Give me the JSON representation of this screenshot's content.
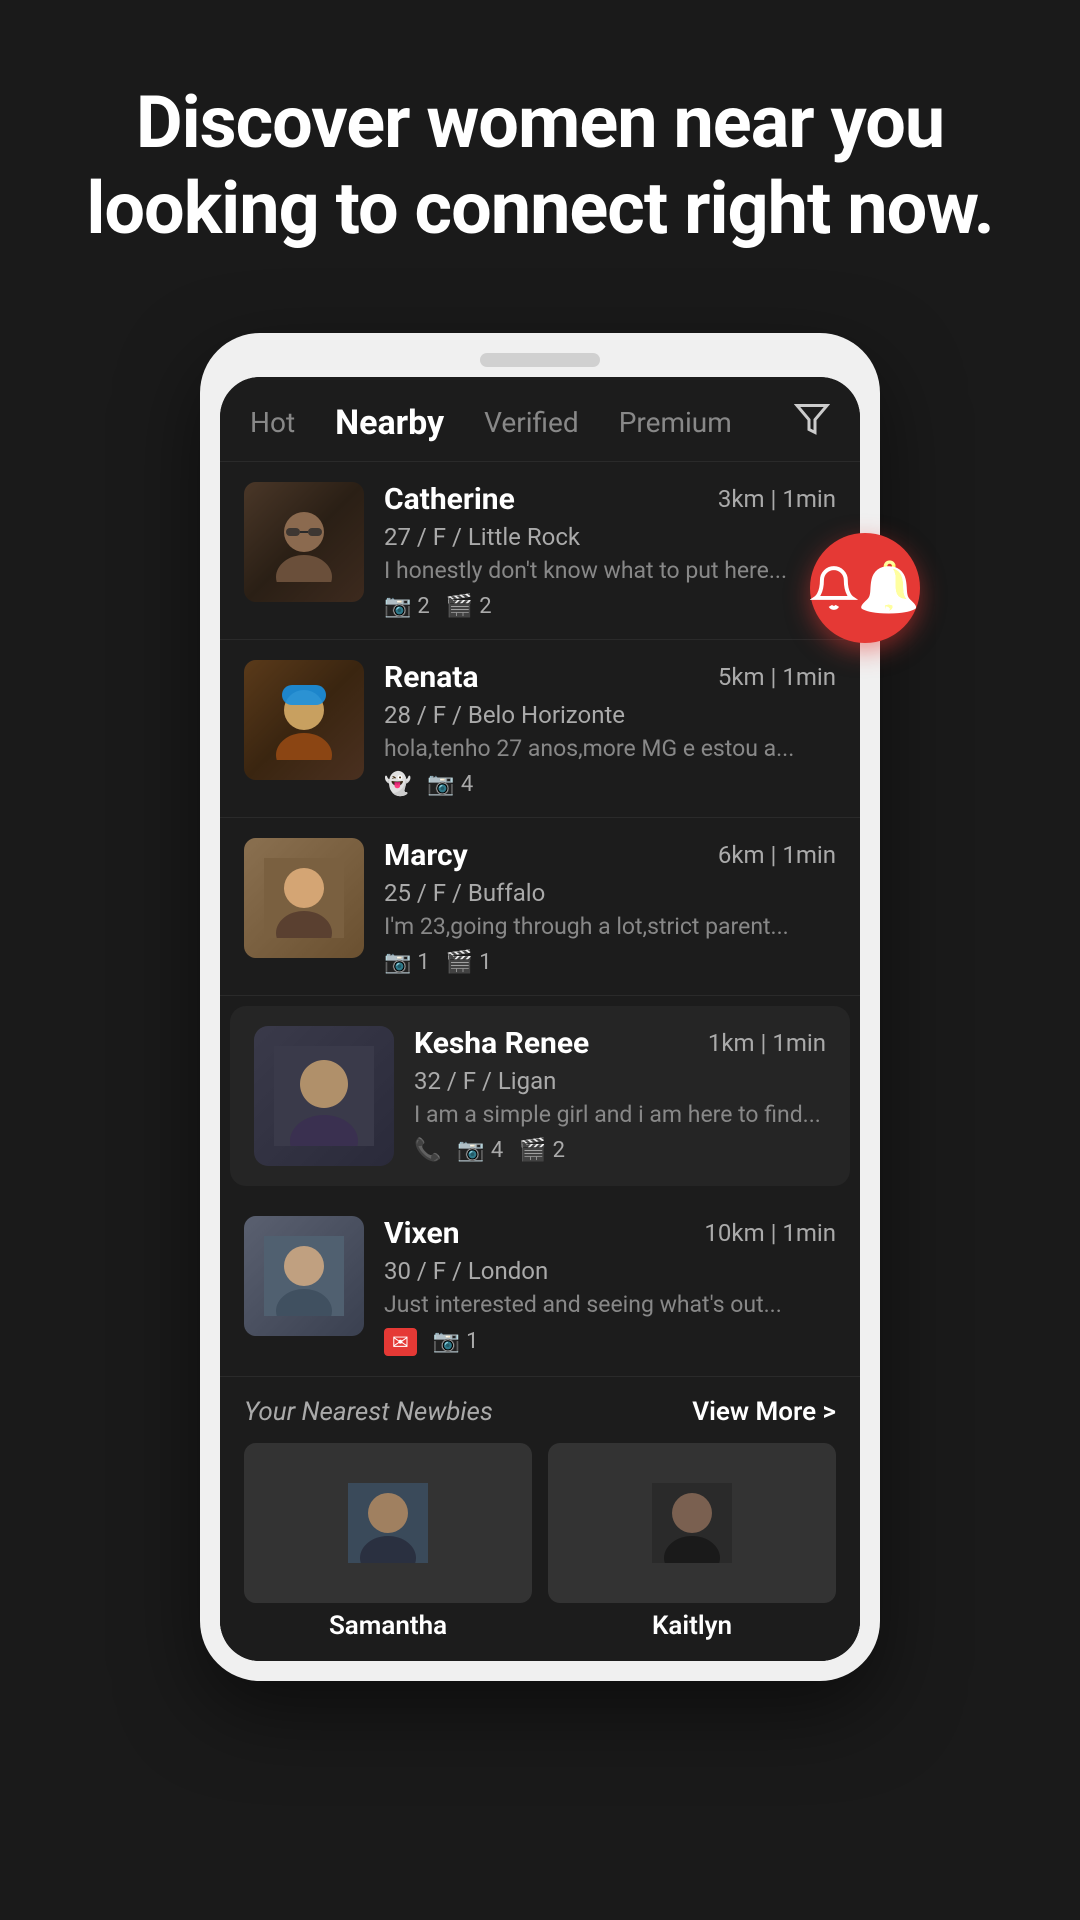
{
  "hero": {
    "title": "Discover women near you looking to connect right now."
  },
  "tabs": {
    "items": [
      {
        "id": "hot",
        "label": "Hot",
        "active": false
      },
      {
        "id": "nearby",
        "label": "Nearby",
        "active": true
      },
      {
        "id": "verified",
        "label": "Verified",
        "active": false
      },
      {
        "id": "premium",
        "label": "Premium",
        "active": false
      }
    ]
  },
  "users": [
    {
      "id": "catherine",
      "name": "Catherine",
      "meta": "27 / F / Little Rock",
      "distance": "3km | 1min",
      "bio": "I honestly don't know what to put here...",
      "badges": [
        {
          "type": "camera",
          "count": 2
        },
        {
          "type": "video",
          "count": 2
        }
      ],
      "highlighted": false
    },
    {
      "id": "renata",
      "name": "Renata",
      "meta": "28 / F / Belo Horizonte",
      "distance": "5km | 1min",
      "bio": "hola,tenho 27 anos,more MG e estou a...",
      "badges": [
        {
          "type": "snap",
          "count": null
        },
        {
          "type": "camera",
          "count": 4
        }
      ],
      "highlighted": false
    },
    {
      "id": "marcy",
      "name": "Marcy",
      "meta": "25 / F / Buffalo",
      "distance": "6km | 1min",
      "bio": "I'm 23,going through a lot,strict parent...",
      "badges": [
        {
          "type": "camera",
          "count": 1
        },
        {
          "type": "video",
          "count": 1
        }
      ],
      "highlighted": false
    },
    {
      "id": "kesha",
      "name": "Kesha Renee",
      "meta": "32 / F / Ligan",
      "distance": "1km | 1min",
      "bio": "I am a simple girl and i am here to find...",
      "badges": [
        {
          "type": "phone",
          "count": null
        },
        {
          "type": "camera",
          "count": 4
        },
        {
          "type": "video",
          "count": 2
        }
      ],
      "highlighted": true
    },
    {
      "id": "vixen",
      "name": "Vixen",
      "meta": "30 / F / London",
      "distance": "10km | 1min",
      "bio": "Just interested and seeing what's out...",
      "badges": [
        {
          "type": "email",
          "count": null
        },
        {
          "type": "camera",
          "count": 1
        }
      ],
      "highlighted": false
    }
  ],
  "newbies": {
    "section_title": "Your Nearest Newbies",
    "view_more_label": "View More >",
    "items": [
      {
        "id": "samantha",
        "name": "Samantha"
      },
      {
        "id": "kaitlyn",
        "name": "Kaitlyn"
      }
    ]
  },
  "fab": {
    "icon": "notification-icon"
  }
}
